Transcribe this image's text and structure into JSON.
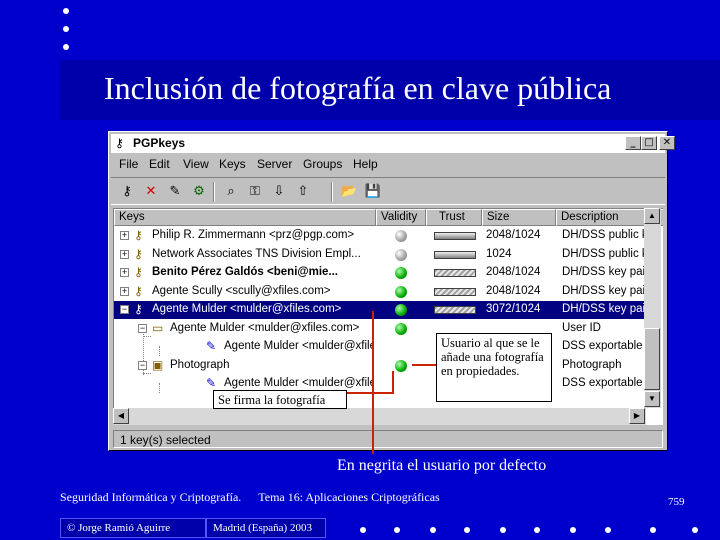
{
  "slide": {
    "title": "Inclusión de fotografía en clave pública",
    "caption": "En negrita el usuario por defecto",
    "footer_left": "Seguridad Informática y Criptografía.",
    "footer_topic": "Tema 16:  Aplicaciones Criptográficas",
    "page_number": "759",
    "author": "© Jorge Ramió Aguirre",
    "place": "Madrid (España) 2003"
  },
  "window": {
    "title": "PGPkeys",
    "menu": [
      "File",
      "Edit",
      "View",
      "Keys",
      "Server",
      "Groups",
      "Help"
    ],
    "toolbar_icons": [
      "keys-icon",
      "delete-icon",
      "sign-icon",
      "certificate-icon",
      "search-icon",
      "key-properties-icon",
      "import-icon",
      "export-icon",
      "folder-open-icon",
      "save-icon"
    ],
    "columns": [
      "Keys",
      "Validity",
      "Trust",
      "Size",
      "Description"
    ],
    "rows": [
      {
        "expander": "+",
        "icon": "key-icon",
        "name": "Philip R. Zimmermann <prz@pgp.com>",
        "bold": false,
        "validity": "gray",
        "trust": "solid",
        "size": "2048/1024",
        "desc": "DH/DSS public key",
        "indent": 0
      },
      {
        "expander": "+",
        "icon": "key-icon",
        "name": "Network Associates TNS Division Empl...",
        "bold": false,
        "validity": "gray",
        "trust": "solid",
        "size": "1024",
        "desc": "DH/DSS public key",
        "indent": 0
      },
      {
        "expander": "+",
        "icon": "keypair-icon",
        "name": "Benito Pérez Galdós <beni@mie...",
        "bold": true,
        "validity": "green",
        "trust": "hatch",
        "size": "2048/1024",
        "desc": "DH/DSS key pair",
        "indent": 0
      },
      {
        "expander": "+",
        "icon": "keypair-icon",
        "name": "Agente Scully <scully@xfiles.com>",
        "bold": false,
        "validity": "green",
        "trust": "hatch",
        "size": "2048/1024",
        "desc": "DH/DSS key pair",
        "indent": 0
      },
      {
        "expander": "−",
        "icon": "keypair-icon",
        "name": "Agente Mulder <mulder@xfiles.com>",
        "bold": false,
        "validity": "green",
        "trust": "hatch",
        "size": "3072/1024",
        "desc": "DH/DSS key pair",
        "indent": 0,
        "selected": true
      },
      {
        "expander": "−",
        "icon": "userid-icon",
        "name": "Agente Mulder <mulder@xfiles.com>",
        "bold": false,
        "validity": "green",
        "trust": "",
        "size": "",
        "desc": "User ID",
        "indent": 1
      },
      {
        "expander": "",
        "icon": "signature-icon",
        "name": "Agente Mulder <mulder@xfiles.c...",
        "bold": false,
        "validity": "",
        "trust": "",
        "size": "",
        "desc": "DSS exportable si...",
        "indent": 2
      },
      {
        "expander": "−",
        "icon": "photo-icon",
        "name": "Photograph",
        "bold": false,
        "validity": "green",
        "trust": "",
        "size": "",
        "desc": "Photograph",
        "indent": 1
      },
      {
        "expander": "",
        "icon": "signature-icon",
        "name": "Agente Mulder <mulder@xfiles.c...",
        "bold": false,
        "validity": "",
        "trust": "",
        "size": "",
        "desc": "DSS exportable si...",
        "indent": 2
      }
    ],
    "status": "1 key(s) selected"
  },
  "callouts": {
    "user": "Usuario al que se le añade una fotografía en propiedades.",
    "signs": "Se firma la fotografía"
  },
  "colors": {
    "background": "#0000cc",
    "selection": "#000080",
    "callout_line": "#cc2200"
  }
}
